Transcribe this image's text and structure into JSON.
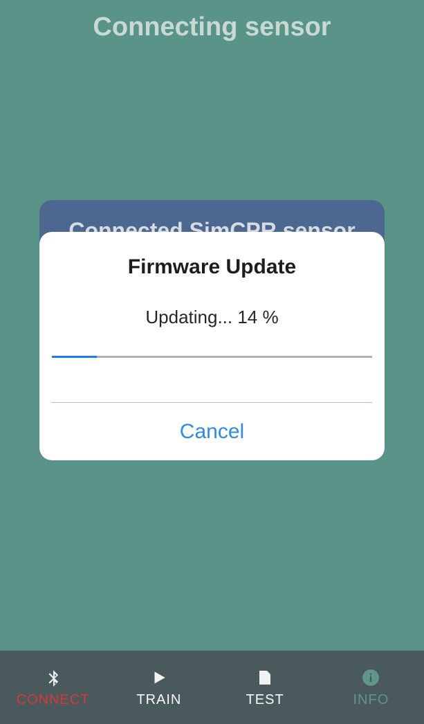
{
  "header": {
    "title": "Connecting sensor"
  },
  "backCard": {
    "title": "Connected SimCPR  sensor"
  },
  "dialog": {
    "title": "Firmware Update",
    "status": "Updating... 14 %",
    "progressPercent": 14,
    "cancelLabel": "Cancel"
  },
  "tabs": {
    "connect": {
      "label": "CONNECT",
      "icon": "bluetooth-icon"
    },
    "train": {
      "label": "TRAIN",
      "icon": "play-icon"
    },
    "test": {
      "label": "TEST",
      "icon": "file-icon"
    },
    "info": {
      "label": "INFO",
      "icon": "info-icon"
    }
  },
  "colors": {
    "background": "#5a9488",
    "tabbar": "#4a595b",
    "activeRed": "#d9383a",
    "infoGreen": "#5e968a",
    "link": "#2e8be6"
  }
}
